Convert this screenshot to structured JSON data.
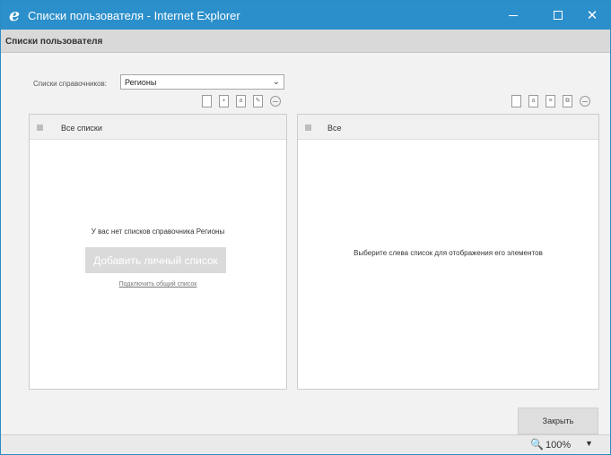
{
  "window": {
    "title": "Списки пользователя - Internet Explorer",
    "ie_icon_glyph": "e",
    "minimize_icon": "minimize-icon",
    "maximize_icon": "maximize-icon",
    "close_glyph": "✕"
  },
  "page": {
    "header": "Списки пользователя"
  },
  "dictionary": {
    "label": "Списки справочников:",
    "selected": "Регионы",
    "chevron": "⌄"
  },
  "left_panel": {
    "title": "Все списки",
    "empty_message": "У вас нет списков справочника Регионы",
    "add_button": "Добавить личный список",
    "connect_link": "Подключить общий список"
  },
  "right_panel": {
    "title": "Все",
    "message": "Выберите слева список для отображения его элементов"
  },
  "footer": {
    "close_button": "Закрыть"
  },
  "statusbar": {
    "zoom_icon": "🔍",
    "zoom": "100%",
    "caret": "▼"
  },
  "colors": {
    "titlebar": "#2b8fcb",
    "header_bg": "#d9d9d9",
    "content_bg": "#f2f2f2"
  }
}
